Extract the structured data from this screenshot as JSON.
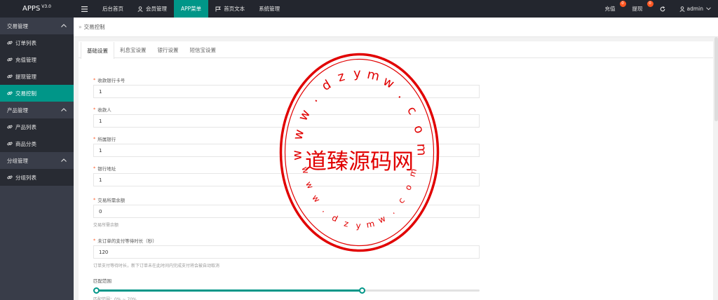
{
  "header": {
    "logo_text": "APPS",
    "logo_version": "V3.0",
    "nav": [
      {
        "label": "",
        "icon": "menu-icon"
      },
      {
        "label": "后台首页",
        "icon": ""
      },
      {
        "label": "会员管理",
        "icon": "user-icon"
      },
      {
        "label": "APP菜单",
        "icon": ""
      },
      {
        "label": "首页文本",
        "icon": "flag-icon"
      },
      {
        "label": "系统管理",
        "icon": ""
      }
    ],
    "recharge_label": "充值",
    "recharge_badge": "0",
    "withdraw_label": "提现",
    "withdraw_badge": "0",
    "refresh_icon": "refresh-icon",
    "user_label": "admin"
  },
  "sidebar": {
    "groups": [
      {
        "label": "交易管理",
        "items": [
          "订单列表",
          "充值管理",
          "提现管理",
          "交易控制"
        ]
      },
      {
        "label": "产品管理",
        "items": [
          "产品列表",
          "商品分类"
        ]
      },
      {
        "label": "分组管理",
        "items": [
          "分组列表"
        ]
      }
    ],
    "active_item": "交易控制"
  },
  "breadcrumb": {
    "current": "交易控制"
  },
  "tabs": [
    "基础设置",
    "利息宝设置",
    "银行设置",
    "短信宝设置"
  ],
  "form": {
    "fields": [
      {
        "label": "收款银行卡号",
        "value": "1",
        "help": ""
      },
      {
        "label": "收款人",
        "value": "1",
        "help": ""
      },
      {
        "label": "所属银行",
        "value": "1",
        "help": ""
      },
      {
        "label": "银行地址",
        "value": "1",
        "help": ""
      },
      {
        "label": "交易所需余额",
        "value": "0",
        "help": "交易所需余额"
      },
      {
        "label": "未订单的支付等待时长（秒）",
        "value": "120",
        "help": "订单支付等待时长，新下订单未在此时间内完成支付将会被自动取消"
      }
    ],
    "slider": {
      "label": "匹配范围",
      "min_percent": 0,
      "max_percent": 70
    }
  },
  "seal": {
    "center_text": "道臻源码网",
    "ring_top": "www.dzymw.com",
    "ring_bottom": "www.dzymw.com",
    "color": "#e10000"
  },
  "colors": {
    "accent": "#009688",
    "header_bg": "#23262e",
    "sidebar_bg": "#393d49",
    "badge": "#ff5722"
  }
}
